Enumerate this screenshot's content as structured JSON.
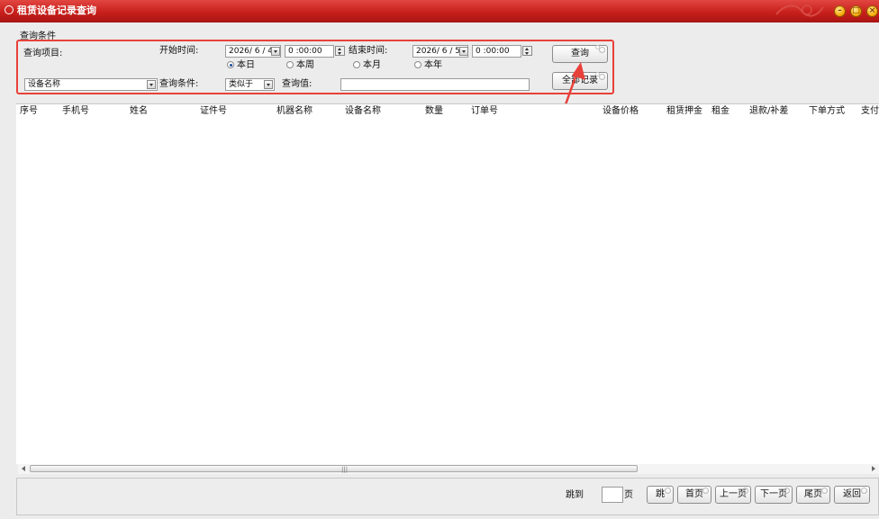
{
  "window": {
    "title": "租赁设备记录查询",
    "colors": {
      "titlebar": "#c8201c",
      "highlight": "#e8413a",
      "arrow": "#e8413a"
    }
  },
  "filter": {
    "group_label": "查询条件",
    "project_label": "查询项目:",
    "start_time_label": "开始时间:",
    "start_date": "2026/ 6 / 4",
    "start_time": "0 :00:00",
    "end_time_label": "结束时间:",
    "end_date": "2026/ 6 / 5",
    "end_time": "0 :00:00",
    "radio_today": "本日",
    "radio_week": "本周",
    "radio_month": "本月",
    "radio_year": "本年",
    "selected_range": "本日",
    "field_select": "设备名称",
    "condition_label": "查询条件:",
    "condition_select": "类似于",
    "value_label": "查询值:",
    "value_input": "",
    "query_button": "查询",
    "all_records_button": "全部记录"
  },
  "table": {
    "columns": [
      "序号",
      "手机号",
      "姓名",
      "证件号",
      "机器名称",
      "设备名称",
      "数量",
      "订单号",
      "设备价格",
      "租赁押金",
      "租金",
      "退款/补差",
      "下单方式",
      "支付"
    ],
    "rows": []
  },
  "pager": {
    "goto_label": "跳到",
    "page_input": "",
    "page_suffix": "页",
    "go_button": "跳",
    "first_button": "首页",
    "prev_button": "上一页",
    "next_button": "下一页",
    "last_button": "尾页",
    "back_button": "返回"
  }
}
